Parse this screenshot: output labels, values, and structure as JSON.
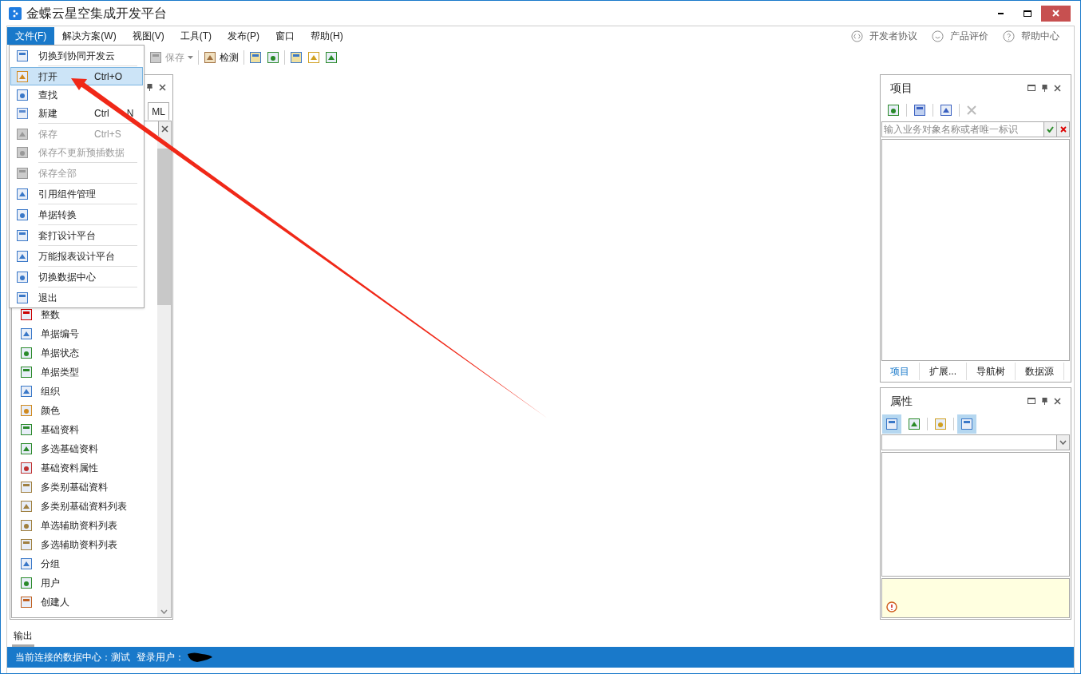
{
  "window": {
    "title": "金蝶云星空集成开发平台"
  },
  "menubar": [
    {
      "label": "文件(F)",
      "selected": true
    },
    {
      "label": "解决方案(W)",
      "selected": false
    },
    {
      "label": "视图(V)",
      "selected": false
    },
    {
      "label": "工具(T)",
      "selected": false
    },
    {
      "label": "发布(P)",
      "selected": false
    },
    {
      "label": "窗口",
      "selected": false
    },
    {
      "label": "帮助(H)",
      "selected": false
    }
  ],
  "help_links": [
    "开发者协议",
    "产品评价",
    "帮助中心"
  ],
  "toolbar": {
    "save": {
      "label": "保存",
      "disabled": true
    },
    "check": {
      "label": "检测"
    }
  },
  "file_menu": [
    {
      "label": "切换到协同开发云",
      "disabled": false,
      "selected": false,
      "divider_after": true
    },
    {
      "label": "打开",
      "shortcut": "Ctrl+O",
      "disabled": false,
      "selected": true,
      "divider_after": false
    },
    {
      "label": "查找",
      "disabled": false,
      "selected": false,
      "divider_after": false
    },
    {
      "label": "新建",
      "shortcut_parts": [
        "Ctrl",
        "N"
      ],
      "disabled": false,
      "selected": false,
      "divider_after": true
    },
    {
      "label": "保存",
      "shortcut": "Ctrl+S",
      "disabled": true,
      "selected": false,
      "divider_after": false
    },
    {
      "label": "保存不更新预插数据",
      "disabled": true,
      "selected": false,
      "divider_after": true
    },
    {
      "label": "保存全部",
      "disabled": true,
      "selected": false,
      "divider_after": true
    },
    {
      "label": "引用组件管理",
      "disabled": false,
      "selected": false,
      "divider_after": true
    },
    {
      "label": "单据转换",
      "disabled": false,
      "selected": false,
      "divider_after": true
    },
    {
      "label": "套打设计平台",
      "disabled": false,
      "selected": false,
      "divider_after": true
    },
    {
      "label": "万能报表设计平台",
      "disabled": false,
      "selected": false,
      "divider_after": true
    },
    {
      "label": "切换数据中心",
      "disabled": false,
      "selected": false,
      "divider_after": true
    },
    {
      "label": "退出",
      "disabled": false,
      "selected": false,
      "divider_after": false
    }
  ],
  "left_panel": {
    "tab_label": "ML",
    "items": [
      "整数",
      "单据编号",
      "单据状态",
      "单据类型",
      "组织",
      "颜色",
      "基础资料",
      "多选基础资料",
      "基础资料属性",
      "多类别基础资料",
      "多类别基础资料列表",
      "单选辅助资料列表",
      "多选辅助资料列表",
      "分组",
      "用户",
      "创建人"
    ]
  },
  "project_panel": {
    "title": "项目",
    "search": {
      "placeholder": "输入业务对象名称或者唯一标识"
    },
    "tabs": [
      {
        "label": "项目",
        "selected": true
      },
      {
        "label": "扩展...",
        "selected": false
      },
      {
        "label": "导航树",
        "selected": false
      },
      {
        "label": "数据源",
        "selected": false
      }
    ]
  },
  "properties_panel": {
    "title": "属性",
    "tools": [
      {
        "selected": true
      },
      {
        "selected": false
      },
      {
        "selected": false
      },
      {
        "selected": true
      }
    ]
  },
  "output_tab": {
    "label": "输出",
    "selected": true
  },
  "status_bar": {
    "data_center": "当前连接的数据中心：测试",
    "user_label": "登录用户："
  }
}
